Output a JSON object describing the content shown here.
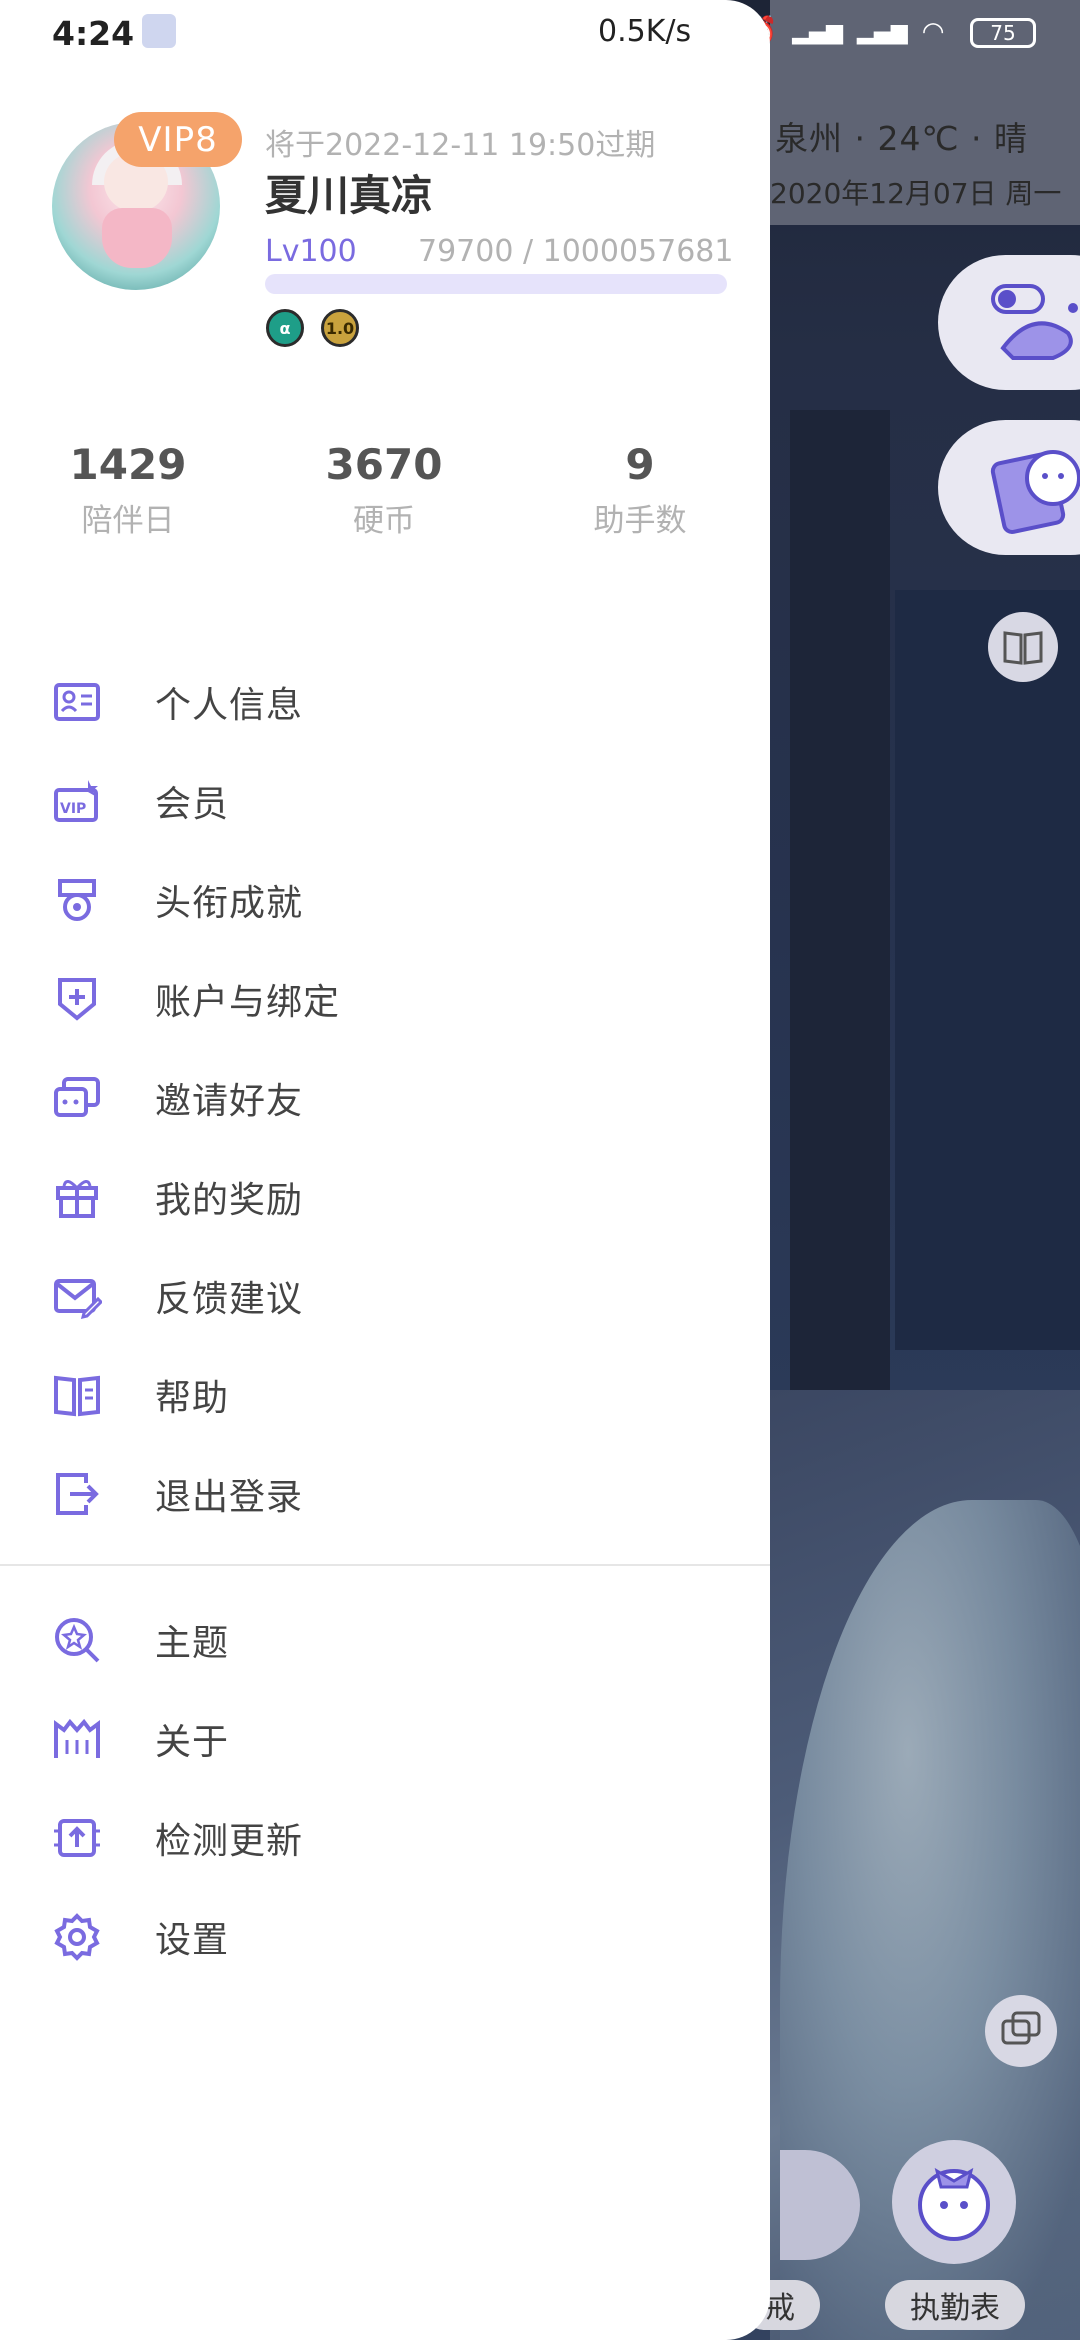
{
  "status_bar": {
    "time": "4:24",
    "net_speed": "0.5K/s",
    "battery": "75"
  },
  "background": {
    "weather": "泉州 · 24℃ · 晴",
    "date": "2020年12月07日 周一",
    "tab_left": "戒",
    "tab_right": "执勤表"
  },
  "profile": {
    "vip": "VIP8",
    "expire": "将于2022-12-11 19:50过期",
    "username": "夏川真凉",
    "level": "Lv100",
    "exp": "79700 / 1000057681",
    "exp_progress": 0.0001,
    "medals": [
      "α",
      "1.0"
    ]
  },
  "stats": [
    {
      "value": "1429",
      "label": "陪伴日"
    },
    {
      "value": "3670",
      "label": "硬币"
    },
    {
      "value": "9",
      "label": "助手数"
    }
  ],
  "menu": [
    {
      "label": "个人信息",
      "icon": "id-card-icon"
    },
    {
      "label": "会员",
      "icon": "vip-icon"
    },
    {
      "label": "头衔成就",
      "icon": "medal-icon"
    },
    {
      "label": "账户与绑定",
      "icon": "shield-plus-icon"
    },
    {
      "label": "邀请好友",
      "icon": "invite-chat-icon"
    },
    {
      "label": "我的奖励",
      "icon": "gift-icon"
    },
    {
      "label": "反馈建议",
      "icon": "feedback-mail-icon"
    },
    {
      "label": "帮助",
      "icon": "help-book-icon"
    },
    {
      "label": "退出登录",
      "icon": "logout-icon"
    }
  ],
  "menu2": [
    {
      "label": "主题",
      "icon": "theme-icon"
    },
    {
      "label": "关于",
      "icon": "about-icon"
    },
    {
      "label": "检测更新",
      "icon": "update-check-icon"
    },
    {
      "label": "设置",
      "icon": "settings-gear-icon"
    }
  ],
  "colors": {
    "accent": "#7a6be0",
    "vip": "#f5a36b"
  }
}
